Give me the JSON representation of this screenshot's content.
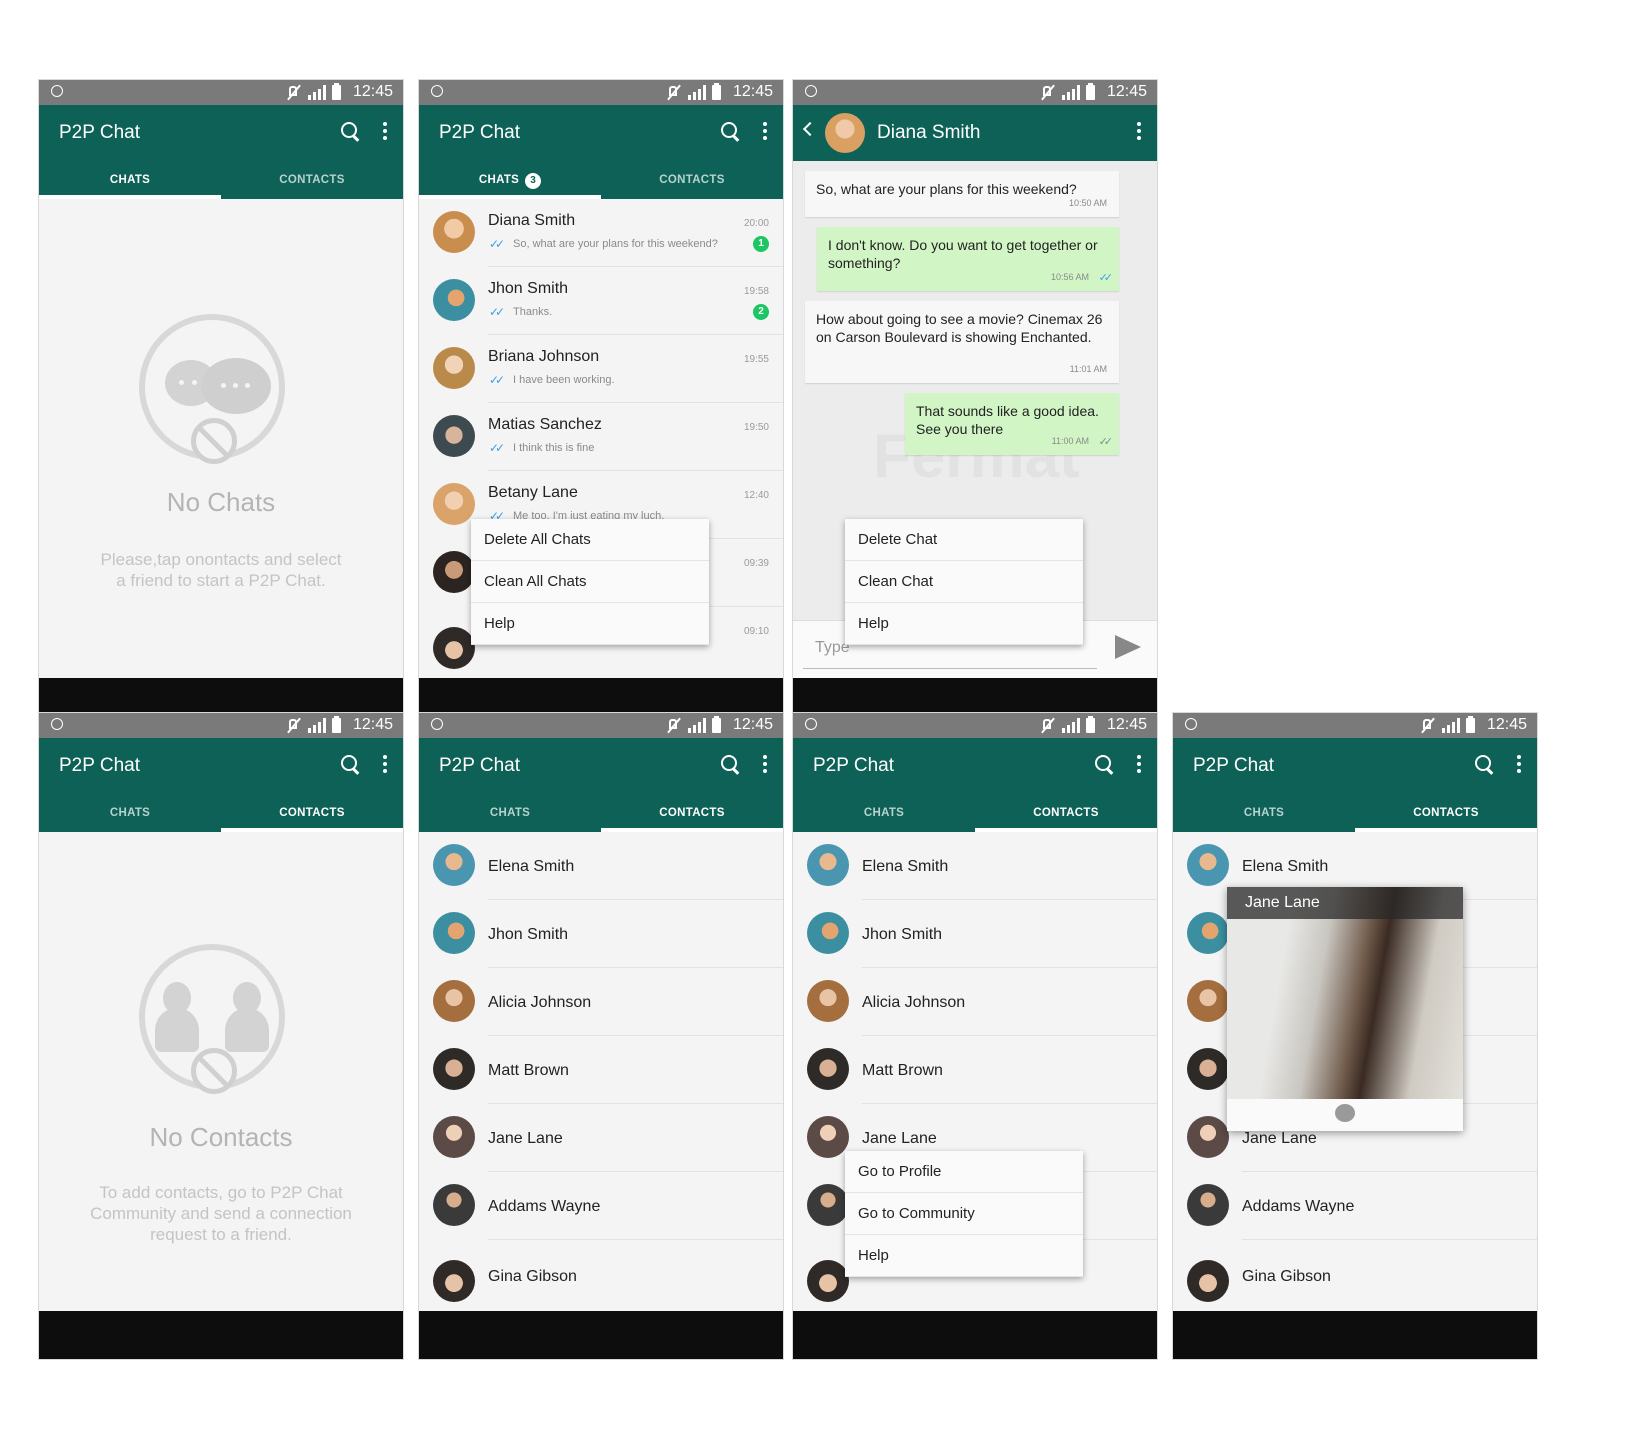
{
  "status": {
    "time": "12:45"
  },
  "app": {
    "title": "P2P Chat",
    "tab_chats": "CHATS",
    "tab_contacts": "CONTACTS",
    "unread_count": "3"
  },
  "empty_chats": {
    "title": "No Chats",
    "line1": "Please,tap onontacts and select",
    "line2": "a friend to start a P2P Chat."
  },
  "empty_contacts": {
    "title": "No Contacts",
    "line1": "To add contacts, go to P2P Chat",
    "line2": "Community and send a connection",
    "line3": "request to a friend."
  },
  "chats": [
    {
      "name": "Diana Smith",
      "msg": "So, what are your plans for this weekend?",
      "time": "20:00",
      "unread": "1"
    },
    {
      "name": "Jhon Smith",
      "msg": "Thanks.",
      "time": "19:58",
      "unread": "2"
    },
    {
      "name": "Briana Johnson",
      "msg": "I have been working.",
      "time": "19:55"
    },
    {
      "name": "Matias Sanchez",
      "msg": "I think this is fine",
      "time": "19:50"
    },
    {
      "name": "Betany Lane",
      "msg": "Me too, I'm just eating my luch.",
      "time": "12:40"
    },
    {
      "name": "",
      "msg": "",
      "time": "09:39"
    },
    {
      "name": "",
      "msg": "",
      "time": "09:10"
    }
  ],
  "chats_menu": {
    "item1": "Delete All Chats",
    "item2": "Clean All Chats",
    "item3": "Help"
  },
  "conversation": {
    "contact": "Diana Smith",
    "messages": [
      {
        "text": "So, what are your plans for this weekend?",
        "time": "10:50 AM"
      },
      {
        "text": "I don't know. Do you want to get together or something?",
        "time": "10:56 AM"
      },
      {
        "text": "How about going to see a movie? Cinemax 26 on Carson Boulevard is showing Enchanted.",
        "time": "11:01 AM"
      },
      {
        "text": "That sounds like a good idea. See you there",
        "time": "11:00 AM"
      }
    ],
    "input_placeholder": "Type",
    "watermark": "Fermat"
  },
  "chat_menu": {
    "item1": "Delete Chat",
    "item2": "Clean Chat",
    "item3": "Help"
  },
  "contacts": [
    "Elena Smith",
    "Jhon Smith",
    "Alicia Johnson",
    "Matt Brown",
    "Jane Lane",
    "Addams Wayne",
    "Gina Gibson"
  ],
  "contact_menu": {
    "item1": "Go to Profile",
    "item2": "Go to Community",
    "item3": "Help"
  },
  "profile_popup": {
    "name": "Jane Lane"
  },
  "colors": {
    "primary": "#0d6157",
    "unread": "#1dc663",
    "outgoing": "#d2f5c5",
    "tick": "#3aa0e0"
  }
}
